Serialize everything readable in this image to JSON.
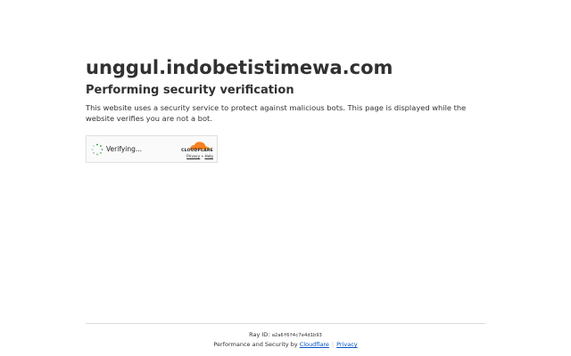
{
  "heading": {
    "domain": "unggul.indobetistimewa.com",
    "subtitle": "Performing security verification",
    "description": "This website uses a security service to protect against malicious bots. This page is displayed while the website verifies you are not a bot."
  },
  "widget": {
    "status": "Verifying...",
    "brand": "CLOUDFLARE",
    "privacy_label": "Privacy",
    "link_sep": "•",
    "help_label": "Help",
    "brand_color": "#f6821f"
  },
  "footer": {
    "ray_label": "Ray ID:",
    "ray_id": "a2a6f6f4c7e4d1b93",
    "perf_prefix": "Performance and Security by",
    "cloudflare_link": "Cloudflare",
    "separator": "|",
    "privacy_link": "Privacy",
    "link_color": "#0051c3"
  }
}
